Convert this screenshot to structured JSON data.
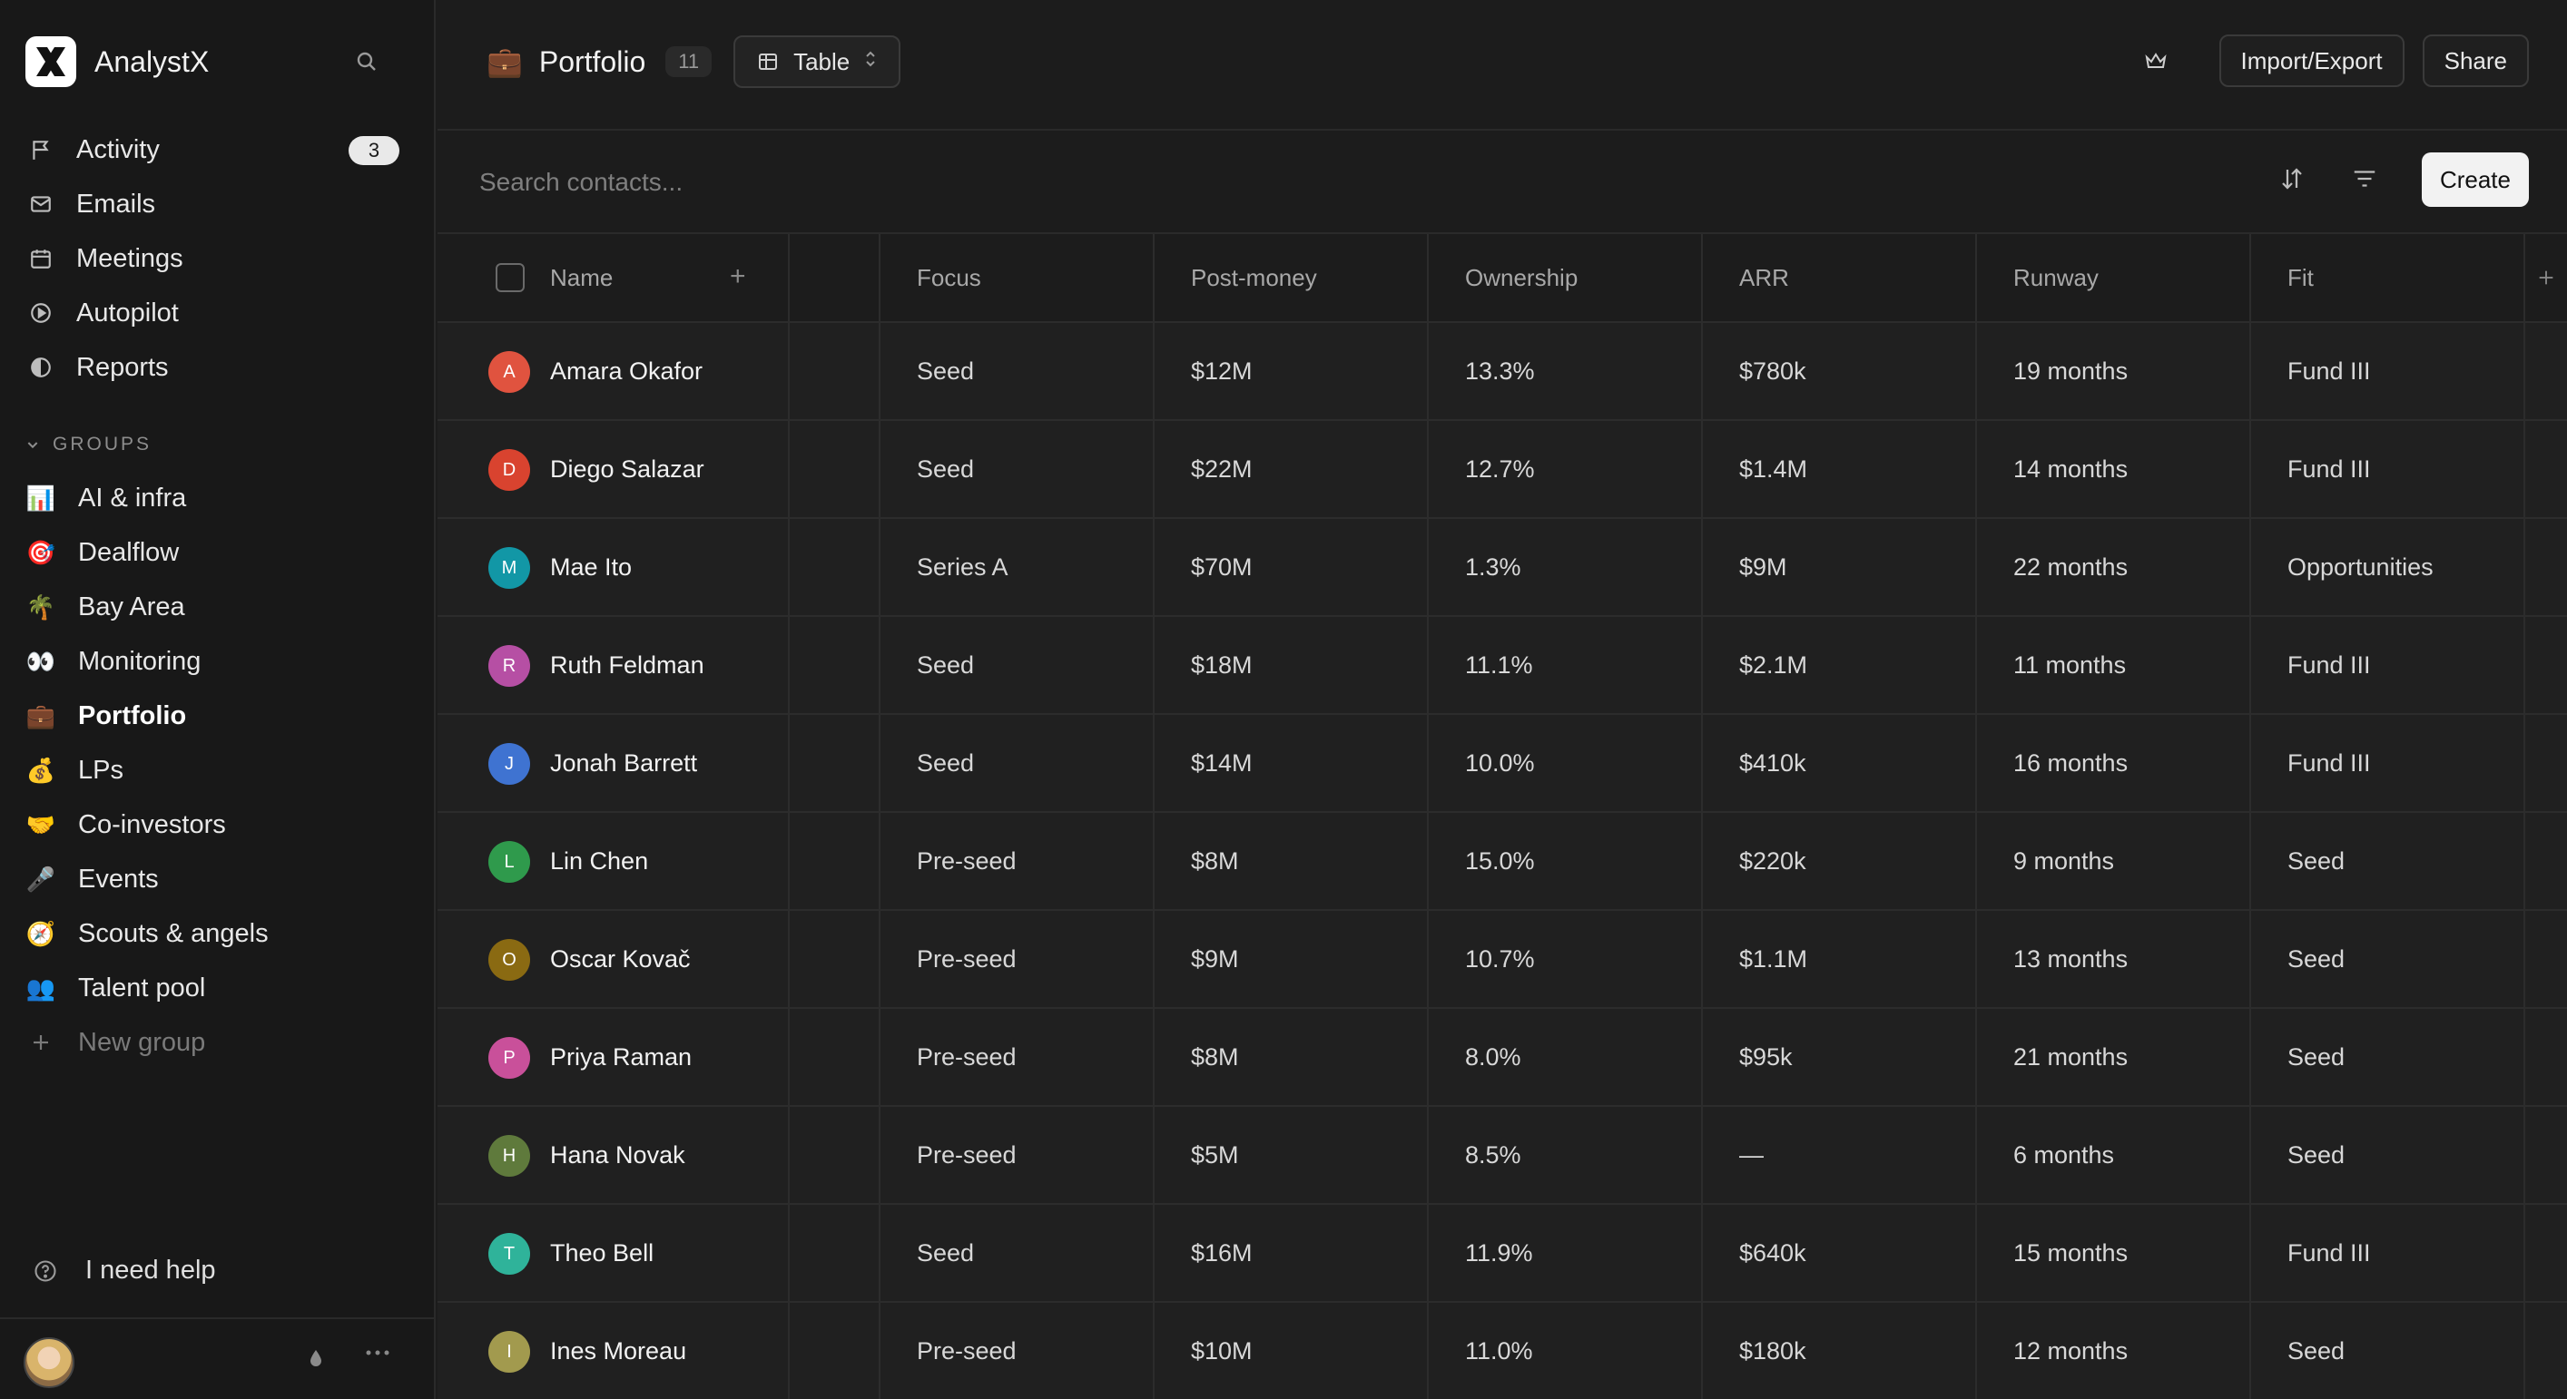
{
  "brand": {
    "name": "AnalystX"
  },
  "nav": [
    {
      "label": "Activity",
      "icon": "flag-icon",
      "badge": "3"
    },
    {
      "label": "Emails",
      "icon": "mail-icon"
    },
    {
      "label": "Meetings",
      "icon": "calendar-icon"
    },
    {
      "label": "Autopilot",
      "icon": "play-circle-icon"
    },
    {
      "label": "Reports",
      "icon": "pie-chart-icon"
    }
  ],
  "groups": {
    "label": "GROUPS",
    "items": [
      {
        "label": "AI & infra",
        "emoji": "📊"
      },
      {
        "label": "Dealflow",
        "emoji": "🎯"
      },
      {
        "label": "Bay Area",
        "emoji": "🌴"
      },
      {
        "label": "Monitoring",
        "emoji": "👀"
      },
      {
        "label": "Portfolio",
        "emoji": "💼",
        "active": true
      },
      {
        "label": "LPs",
        "emoji": "💰"
      },
      {
        "label": "Co-investors",
        "emoji": "🤝"
      },
      {
        "label": "Events",
        "emoji": "🎤"
      },
      {
        "label": "Scouts & angels",
        "emoji": "🧭"
      },
      {
        "label": "Talent pool",
        "emoji": "👥"
      }
    ],
    "new_group": "New group"
  },
  "help": "I need help",
  "header": {
    "emoji": "💼",
    "title": "Portfolio",
    "count": "11",
    "view": "Table",
    "import_export": "Import/Export",
    "share": "Share"
  },
  "search": {
    "placeholder": "Search contacts..."
  },
  "create_label": "Create",
  "columns": [
    "Name",
    "Focus",
    "Post-money",
    "Ownership",
    "ARR",
    "Runway",
    "Fit"
  ],
  "rows": [
    {
      "initial": "A",
      "color": "#e0533f",
      "name": "Amara Okafor",
      "focus": "Seed",
      "post": "$12M",
      "own": "13.3%",
      "arr": "$780k",
      "runway": "19 months",
      "fit": "Fund III"
    },
    {
      "initial": "D",
      "color": "#d9432f",
      "name": "Diego Salazar",
      "focus": "Seed",
      "post": "$22M",
      "own": "12.7%",
      "arr": "$1.4M",
      "runway": "14 months",
      "fit": "Fund III"
    },
    {
      "initial": "M",
      "color": "#1297a6",
      "name": "Mae Ito",
      "focus": "Series A",
      "post": "$70M",
      "own": "1.3%",
      "arr": "$9M",
      "runway": "22 months",
      "fit": "Opportunities"
    },
    {
      "initial": "R",
      "color": "#b64fa4",
      "name": "Ruth Feldman",
      "focus": "Seed",
      "post": "$18M",
      "own": "11.1%",
      "arr": "$2.1M",
      "runway": "11 months",
      "fit": "Fund III"
    },
    {
      "initial": "J",
      "color": "#3f73d1",
      "name": "Jonah Barrett",
      "focus": "Seed",
      "post": "$14M",
      "own": "10.0%",
      "arr": "$410k",
      "runway": "16 months",
      "fit": "Fund III"
    },
    {
      "initial": "L",
      "color": "#2f9a4c",
      "name": "Lin Chen",
      "focus": "Pre-seed",
      "post": "$8M",
      "own": "15.0%",
      "arr": "$220k",
      "runway": "9 months",
      "fit": "Seed"
    },
    {
      "initial": "O",
      "color": "#8a6a12",
      "name": "Oscar Kovač",
      "focus": "Pre-seed",
      "post": "$9M",
      "own": "10.7%",
      "arr": "$1.1M",
      "runway": "13 months",
      "fit": "Seed"
    },
    {
      "initial": "P",
      "color": "#c9509a",
      "name": "Priya Raman",
      "focus": "Pre-seed",
      "post": "$8M",
      "own": "8.0%",
      "arr": "$95k",
      "runway": "21 months",
      "fit": "Seed"
    },
    {
      "initial": "H",
      "color": "#5f7a3c",
      "name": "Hana Novak",
      "focus": "Pre-seed",
      "post": "$5M",
      "own": "8.5%",
      "arr": "—",
      "runway": "6 months",
      "fit": "Seed"
    },
    {
      "initial": "T",
      "color": "#2fb39a",
      "name": "Theo Bell",
      "focus": "Seed",
      "post": "$16M",
      "own": "11.9%",
      "arr": "$640k",
      "runway": "15 months",
      "fit": "Fund III"
    },
    {
      "initial": "I",
      "color": "#a29a4e",
      "name": "Ines Moreau",
      "focus": "Pre-seed",
      "post": "$10M",
      "own": "11.0%",
      "arr": "$180k",
      "runway": "12 months",
      "fit": "Seed"
    }
  ]
}
